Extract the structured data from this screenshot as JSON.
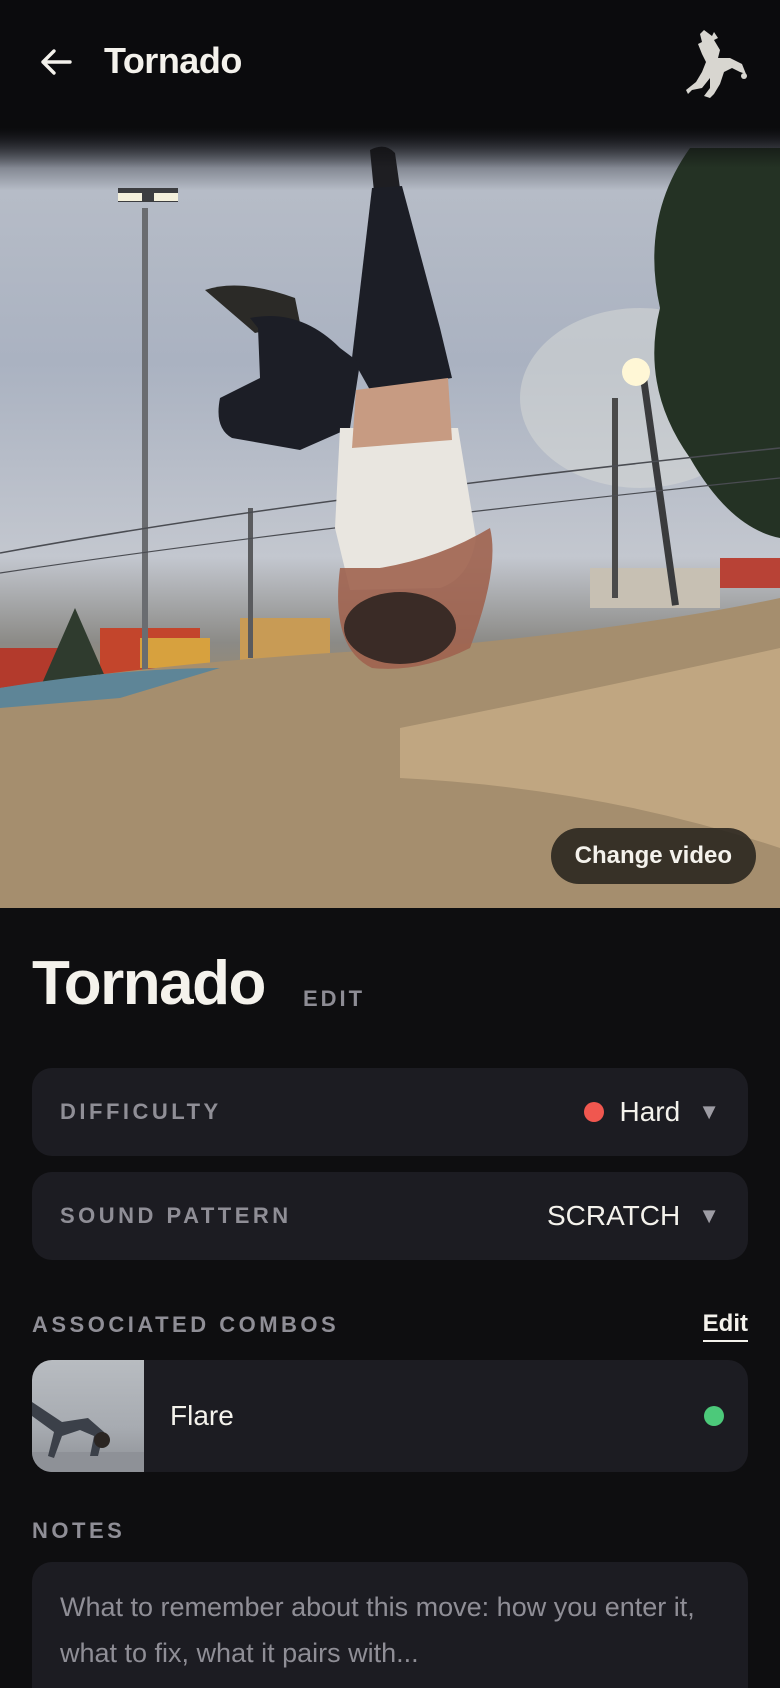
{
  "header": {
    "title": "Tornado",
    "back_icon": "arrow-left-icon",
    "logo_icon": "breakdancer-logo"
  },
  "video": {
    "change_label": "Change video"
  },
  "move": {
    "title": "Tornado",
    "edit_label": "EDIT"
  },
  "fields": {
    "difficulty": {
      "label": "DIFFICULTY",
      "value": "Hard",
      "dot_color": "#f0574f"
    },
    "sound_pattern": {
      "label": "SOUND PATTERN",
      "value": "SCRATCH"
    }
  },
  "combos": {
    "label": "ASSOCIATED COMBOS",
    "edit_label": "Edit",
    "items": [
      {
        "name": "Flare",
        "status_color": "#4cc97a"
      }
    ]
  },
  "notes": {
    "label": "NOTES",
    "placeholder": "What to remember about this move: how you enter it, what to fix, what it pairs with..."
  },
  "colors": {
    "background": "#0e0e10",
    "card": "#1c1c22",
    "text": "#f4f2ec",
    "muted": "#8f8e96"
  }
}
